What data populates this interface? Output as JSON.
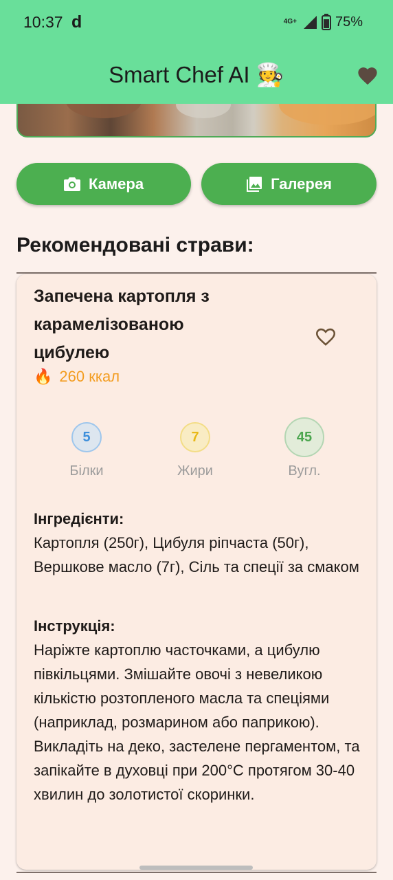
{
  "status_bar": {
    "time": "10:37",
    "notification_glyph": "d",
    "network": "4G+",
    "battery": "75%"
  },
  "app_bar": {
    "title": "Smart Chef AI 🧑‍🍳",
    "favorites_icon": "heart-filled-icon"
  },
  "actions": {
    "camera_label": "Камера",
    "gallery_label": "Галерея"
  },
  "section": {
    "title": "Рекомендовані страви:"
  },
  "recipe": {
    "title": "Запечена картопля з карамелізованою цибулею",
    "calories_icon": "🔥",
    "calories": "260 ккал",
    "favorite_icon": "heart-outline-icon",
    "macros": [
      {
        "value": "5",
        "label": "Білки",
        "color": "#3d8fdb"
      },
      {
        "value": "7",
        "label": "Жири",
        "color": "#e8b818"
      },
      {
        "value": "45",
        "label": "Вугл.",
        "color": "#4aa54e"
      }
    ],
    "ingredients_label": "Інгредієнти:",
    "ingredients": "Картопля (250г), Цибуля ріпчаста (50г), Вершкове масло (7г), Сіль та спеції за смаком",
    "instructions_label": "Інструкція:",
    "instructions": "Наріжте картоплю часточками, а цибулю півкільцями. Змішайте овочі з невеликою кількістю розтопленого масла та спеціями (наприклад, розмарином або паприкою). Викладіть на деко, застелене пергаментом, та запікайте в духовці при 200°C протягом 30-40 хвилин до золотистої скоринки."
  },
  "colors": {
    "app_bar": "#69df9a",
    "primary_button": "#4caf50",
    "background": "#fcf1ec",
    "card": "#fcece3",
    "calories": "#f39c1f"
  }
}
